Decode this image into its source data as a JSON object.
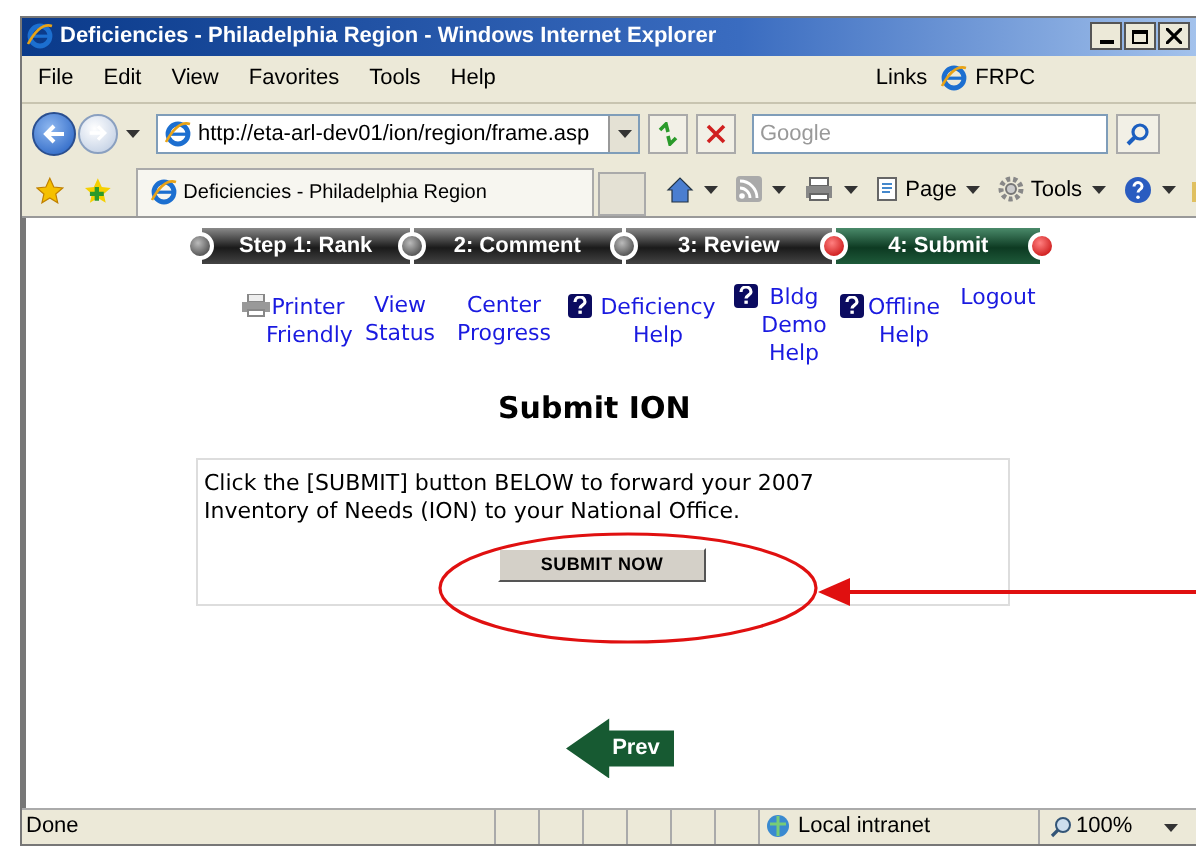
{
  "window": {
    "title": "Deficiencies - Philadelphia Region - Windows Internet Explorer"
  },
  "menu": [
    "File",
    "Edit",
    "View",
    "Favorites",
    "Tools",
    "Help"
  ],
  "links_bar": {
    "label": "Links",
    "link": "FRPC"
  },
  "address": {
    "value": "http://eta-arl-dev01/ion/region/frame.asp"
  },
  "search": {
    "placeholder": "Google"
  },
  "tab": {
    "title": "Deficiencies - Philadelphia Region"
  },
  "toolbar": [
    "Page",
    "Tools"
  ],
  "steps": [
    {
      "label": "Step 1: Rank",
      "selected": false
    },
    {
      "label": "2: Comment",
      "selected": false
    },
    {
      "label": "3: Review",
      "selected": false
    },
    {
      "label": "4: Submit",
      "selected": true
    }
  ],
  "nav_links": [
    {
      "label": "Printer Friendly",
      "kind": "printer"
    },
    {
      "label": "View Status",
      "kind": "plain"
    },
    {
      "label": "Center Progress",
      "kind": "plain"
    },
    {
      "label": "Deficiency Help",
      "kind": "help"
    },
    {
      "label": "Bldg Demo Help",
      "kind": "help"
    },
    {
      "label": "Offline Help",
      "kind": "help"
    },
    {
      "label": "Logout",
      "kind": "plain"
    }
  ],
  "heading": "Submit ION",
  "message": "Click the [SUBMIT] button BELOW to forward your 2007 Inventory of Needs (ION) to your National Office.",
  "submit_button": "SUBMIT NOW",
  "prev_button": "Prev",
  "status_bar": {
    "text": "Done",
    "zone": "Local intranet",
    "zoom": "100%"
  }
}
